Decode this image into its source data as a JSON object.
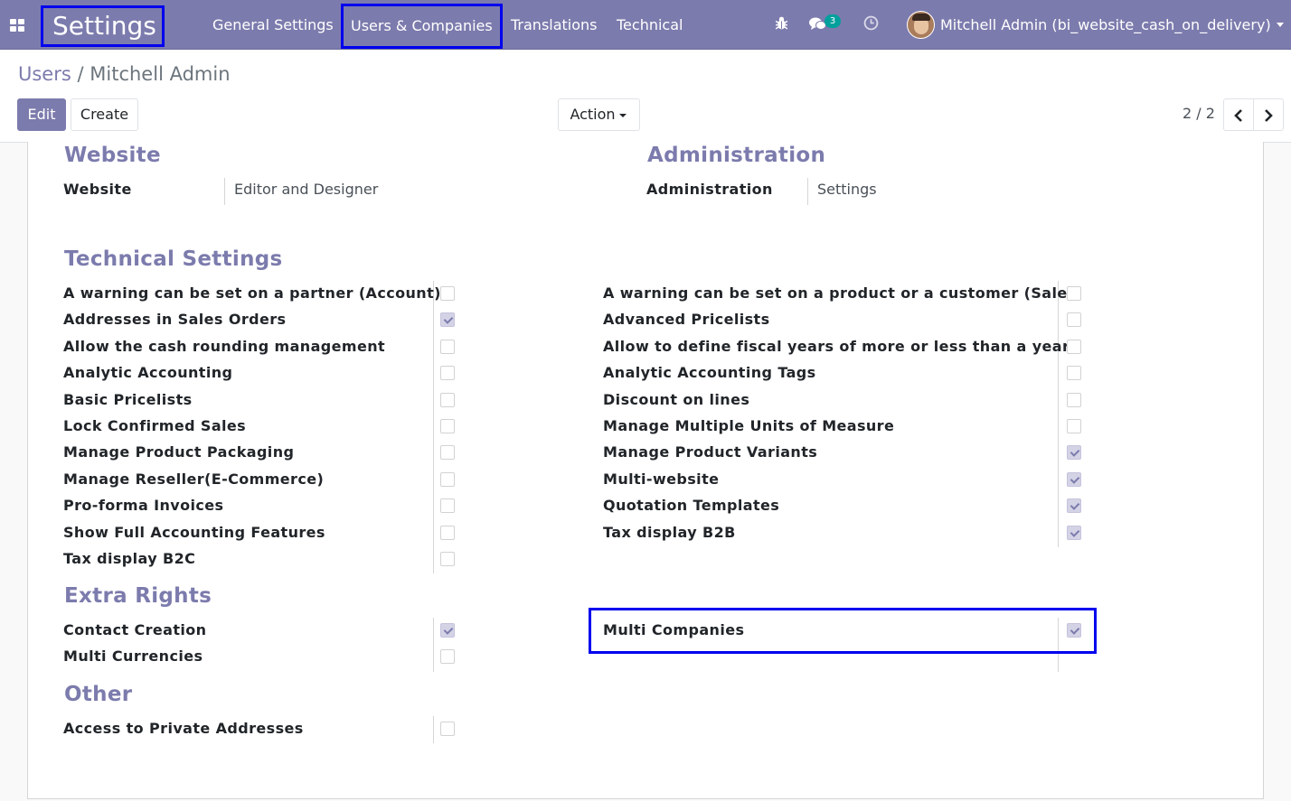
{
  "navbar": {
    "app_title": "Settings",
    "menu": [
      "General Settings",
      "Users & Companies",
      "Translations",
      "Technical"
    ],
    "messages_badge": "3",
    "user_name": "Mitchell Admin (bi_website_cash_on_delivery)"
  },
  "breadcrumb": {
    "parent": "Users",
    "separator": "/",
    "current": "Mitchell Admin"
  },
  "buttons": {
    "edit": "Edit",
    "create": "Create",
    "action": "Action"
  },
  "pager": {
    "value": "2 / 2"
  },
  "website_group": {
    "title": "Website",
    "label": "Website",
    "value": "Editor and Designer"
  },
  "administration_group": {
    "title": "Administration",
    "label": "Administration",
    "value": "Settings"
  },
  "technical_settings": {
    "title": "Technical Settings",
    "left": [
      {
        "label": "A warning can be set on a partner (Account)",
        "checked": false
      },
      {
        "label": "Addresses in Sales Orders",
        "checked": true
      },
      {
        "label": "Allow the cash rounding management",
        "checked": false
      },
      {
        "label": "Analytic Accounting",
        "checked": false
      },
      {
        "label": "Basic Pricelists",
        "checked": false
      },
      {
        "label": "Lock Confirmed Sales",
        "checked": false
      },
      {
        "label": "Manage Product Packaging",
        "checked": false
      },
      {
        "label": "Manage Reseller(E-Commerce)",
        "checked": false
      },
      {
        "label": "Pro-forma Invoices",
        "checked": false
      },
      {
        "label": "Show Full Accounting Features",
        "checked": false
      },
      {
        "label": "Tax display B2C",
        "checked": false
      }
    ],
    "right": [
      {
        "label": "A warning can be set on a product or a customer (Sale)",
        "checked": false
      },
      {
        "label": "Advanced Pricelists",
        "checked": false
      },
      {
        "label": "Allow to define fiscal years of more or less than a year",
        "checked": false
      },
      {
        "label": "Analytic Accounting Tags",
        "checked": false
      },
      {
        "label": "Discount on lines",
        "checked": false
      },
      {
        "label": "Manage Multiple Units of Measure",
        "checked": false
      },
      {
        "label": "Manage Product Variants",
        "checked": true
      },
      {
        "label": "Multi-website",
        "checked": true
      },
      {
        "label": "Quotation Templates",
        "checked": true
      },
      {
        "label": "Tax display B2B",
        "checked": true
      }
    ]
  },
  "extra_rights": {
    "title": "Extra Rights",
    "left": [
      {
        "label": "Contact Creation",
        "checked": true
      },
      {
        "label": "Multi Currencies",
        "checked": false
      }
    ],
    "right": [
      {
        "label": "Multi Companies",
        "checked": true
      }
    ]
  },
  "other": {
    "title": "Other",
    "left": [
      {
        "label": "Access to Private Addresses",
        "checked": false
      }
    ]
  },
  "colors": {
    "brand": "#7c7bad",
    "highlight_box": "#0000ee",
    "badge": "#00a09d"
  }
}
